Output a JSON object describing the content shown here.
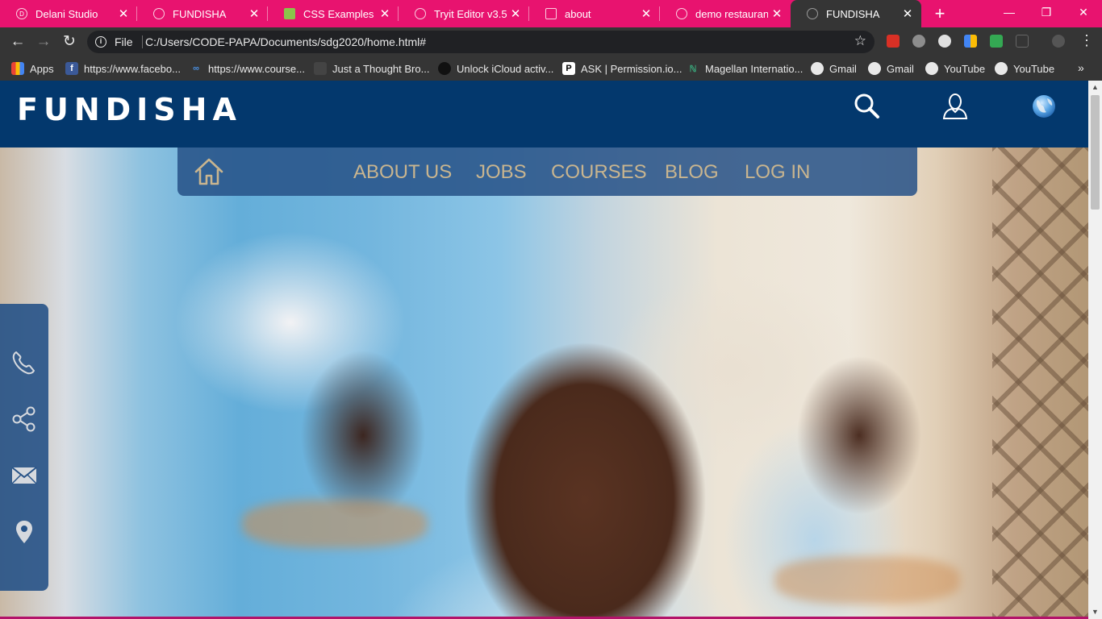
{
  "browser": {
    "tabs": [
      {
        "title": "Delani Studio",
        "active": false
      },
      {
        "title": "FUNDISHA",
        "active": false
      },
      {
        "title": "CSS Examples",
        "active": false
      },
      {
        "title": "Tryit Editor v3.5",
        "active": false
      },
      {
        "title": "about",
        "active": false
      },
      {
        "title": "demo restaurant",
        "active": false
      },
      {
        "title": "FUNDISHA",
        "active": true
      }
    ],
    "new_tab_symbol": "+",
    "window_controls": {
      "minimize": "—",
      "restore": "❐",
      "close": "✕"
    },
    "address": {
      "scheme_label": "File",
      "url": "C:/Users/CODE-PAPA/Documents/sdg2020/home.html#"
    },
    "bookmarks": [
      {
        "label": "Apps",
        "icon": "apps-grid-icon"
      },
      {
        "label": "https://www.facebo...",
        "icon": "facebook-icon"
      },
      {
        "label": "https://www.course...",
        "icon": "coursera-icon"
      },
      {
        "label": "Just a Thought Bro...",
        "icon": "page-icon"
      },
      {
        "label": "Unlock iCloud activ...",
        "icon": "apple-icon"
      },
      {
        "label": "ASK | Permission.io...",
        "icon": "permission-icon"
      },
      {
        "label": "Magellan Internatio...",
        "icon": "magellan-icon"
      },
      {
        "label": "Gmail",
        "icon": "globe-icon"
      },
      {
        "label": "Gmail",
        "icon": "globe-icon"
      },
      {
        "label": "YouTube",
        "icon": "globe-icon"
      },
      {
        "label": "YouTube",
        "icon": "globe-icon"
      }
    ],
    "bookmarks_more": "»",
    "colors": {
      "tabstrip": "#e8136f",
      "toolbar": "#353535"
    }
  },
  "site": {
    "logo": "FUNDISHA",
    "header_icons": [
      "search-icon",
      "user-icon",
      "globe-icon"
    ],
    "nav": {
      "home_icon": "home-icon",
      "links": [
        "ABOUT US",
        "JOBS",
        "COURSES",
        "BLOG",
        "LOG IN"
      ]
    },
    "side_icons": [
      "phone-icon",
      "share-icon",
      "mail-icon",
      "location-pin-icon"
    ],
    "hero_image": "smiling schoolboy in classroom",
    "colors": {
      "header": "#03386d",
      "nav": "#265287",
      "nav_text": "#c9b58f",
      "icons": "#d6d9de"
    }
  }
}
